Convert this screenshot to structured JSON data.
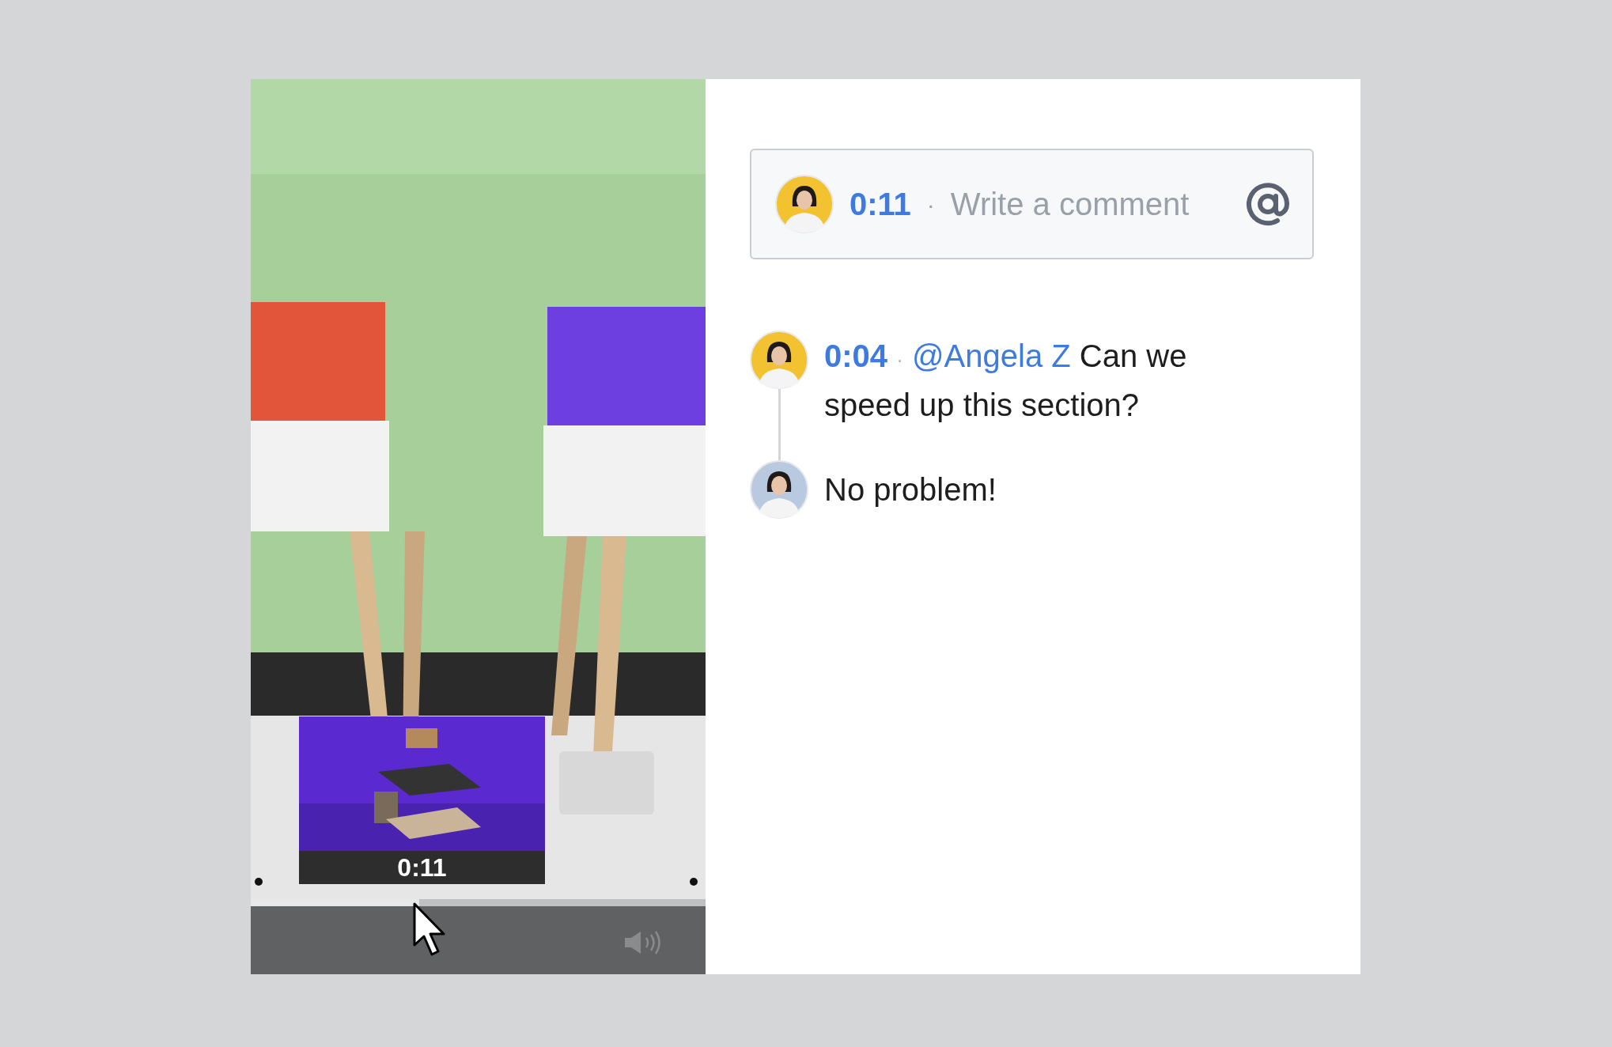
{
  "video": {
    "kind": "picture",
    "preview": {
      "time": "0:11"
    },
    "progress": {
      "level": 0.37
    }
  },
  "comment_box": {
    "time": "0:11",
    "separator": "·",
    "placeholder": "Write a comment"
  },
  "comments": [
    {
      "time": "0:04",
      "separator": "·",
      "mention": "@Angela Z",
      "text": "Can we speed up this section?",
      "color": "#f2c230",
      "replies": [
        {
          "text": "No problem!",
          "color": "#b9c9e0"
        }
      ]
    }
  ]
}
